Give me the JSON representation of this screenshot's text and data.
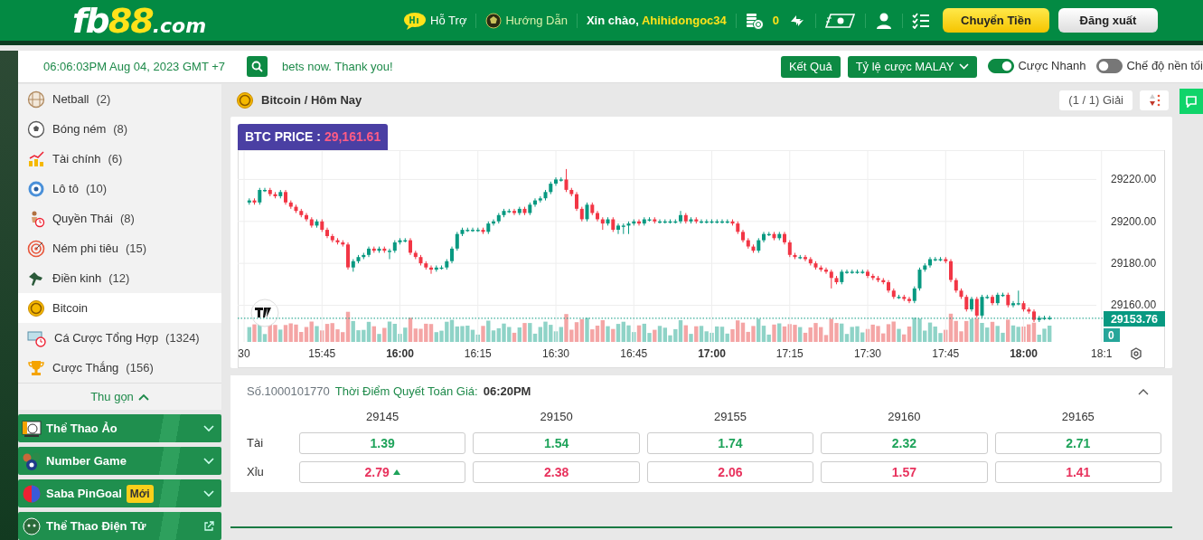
{
  "header": {
    "logo": {
      "part_1": "fb",
      "part_2": "88",
      "part_3": ".com"
    },
    "links": [
      {
        "label": "Hỗ Trợ",
        "kind": "support"
      },
      {
        "label": "Hướng Dẫn",
        "kind": "guide"
      }
    ],
    "greeting": "Xin chào,",
    "username": "Ahihidongoc34",
    "balance": "0",
    "transfer_button": "Chuyển Tiền",
    "logout_button": "Đăng xuất"
  },
  "toolbar": {
    "clock": "06:06:03PM Aug 04, 2023 GMT +7",
    "ticker": "bets now. Thank you!",
    "results_button": "Kết Quả",
    "odds_dropdown": "Tỷ lệ cược MALAY",
    "toggles": [
      {
        "label": "Cược Nhanh",
        "on": true
      },
      {
        "label": "Chế độ nền tối",
        "on": false
      }
    ]
  },
  "sidebar": {
    "items": [
      {
        "label": "Netball",
        "count": "(2)",
        "kind": "netball",
        "selected": false
      },
      {
        "label": "Bóng ném",
        "count": "(8)",
        "kind": "handball",
        "selected": false
      },
      {
        "label": "Tài chính",
        "count": "(6)",
        "kind": "finance",
        "selected": false
      },
      {
        "label": "Lô tô",
        "count": "(10)",
        "kind": "lotto",
        "selected": false
      },
      {
        "label": "Quyền Thái",
        "count": "(8)",
        "kind": "boxing",
        "selected": false
      },
      {
        "label": "Ném phi tiêu",
        "count": "(15)",
        "kind": "darts",
        "selected": false
      },
      {
        "label": "Điền kinh",
        "count": "(12)",
        "kind": "athletics",
        "selected": false
      },
      {
        "label": "Bitcoin",
        "kind": "bitcoin",
        "selected": true
      },
      {
        "label": "Cá Cược Tổng Hợp",
        "count": "(1324)",
        "kind": "combo",
        "selected": false
      },
      {
        "label": "Cược Thắng",
        "count": "(156)",
        "kind": "trophy",
        "selected": false
      }
    ],
    "collapse_label": "Thu gọn",
    "sections": [
      {
        "label": "Thể Thao Ảo",
        "kind": "virtual"
      },
      {
        "label": "Number Game",
        "kind": "number"
      },
      {
        "label": "Saba PinGoal",
        "kind": "pingoal",
        "badge": "Mới"
      },
      {
        "label": "Thể Thao Điện Tử",
        "kind": "esports"
      }
    ]
  },
  "main": {
    "breadcrumb": "Bitcoin / Hôm Nay",
    "league_counter": "(1 / 1) Giải",
    "price_badge": {
      "label": "BTC PRICE :",
      "value": "29,161.61"
    },
    "price_chart": {
      "last_price": "29153.76",
      "volume": "0",
      "chart_data": {
        "type": "candlestick",
        "categories": [
          "30",
          null,
          null,
          null,
          null,
          null,
          null,
          null,
          null,
          null,
          null,
          null,
          null,
          null,
          null,
          "15:45",
          null,
          null,
          null,
          null,
          null,
          null,
          null,
          null,
          null,
          null,
          null,
          null,
          null,
          null,
          "16:00",
          null,
          null,
          null,
          null,
          null,
          null,
          null,
          null,
          null,
          null,
          null,
          null,
          null,
          null,
          "16:15",
          null,
          null,
          null,
          null,
          null,
          null,
          null,
          null,
          null,
          null,
          null,
          null,
          null,
          null,
          "16:30",
          null,
          null,
          null,
          null,
          null,
          null,
          null,
          null,
          null,
          null,
          null,
          null,
          null,
          null,
          "16:45",
          null,
          null,
          null,
          null,
          null,
          null,
          null,
          null,
          null,
          null,
          null,
          null,
          null,
          null,
          "17:00",
          null,
          null,
          null,
          null,
          null,
          null,
          null,
          null,
          null,
          null,
          null,
          null,
          null,
          null,
          "17:15",
          null,
          null,
          null,
          null,
          null,
          null,
          null,
          null,
          null,
          null,
          null,
          null,
          null,
          null,
          "17:30",
          null,
          null,
          null,
          null,
          null,
          null,
          null,
          null,
          null,
          null,
          null,
          null,
          null,
          null,
          "17:45",
          null,
          null,
          null,
          null,
          null,
          null,
          null,
          null,
          null,
          null,
          null,
          null,
          null,
          null,
          "18:00",
          null,
          null,
          null,
          null,
          null,
          null,
          null,
          null,
          null,
          null,
          null,
          null,
          null,
          null,
          "18:1"
        ],
        "ohlc": [
          null,
          [
            29209,
            29211,
            29208,
            29210
          ],
          [
            29210,
            29211,
            29208,
            29209
          ],
          [
            29209,
            29216,
            29208,
            29215
          ],
          [
            29215,
            29216,
            29214,
            29215
          ],
          [
            29215,
            29216,
            29212,
            29213
          ],
          [
            29213,
            29214,
            29211,
            29212
          ],
          [
            29212,
            29215,
            29211,
            29214
          ],
          [
            29214,
            29215,
            29208,
            29209
          ],
          [
            29209,
            29210,
            29206,
            29207
          ],
          [
            29207,
            29208,
            29204,
            29205
          ],
          [
            29205,
            29206,
            29202,
            29203
          ],
          [
            29203,
            29204,
            29200,
            29201
          ],
          [
            29201,
            29202,
            29197,
            29198
          ],
          [
            29198,
            29201,
            29197,
            29200
          ],
          [
            29200,
            29201,
            29195,
            29196
          ],
          [
            29196,
            29197,
            29192,
            29193
          ],
          [
            29193,
            29194,
            29190,
            29191
          ],
          [
            29191,
            29192,
            29189,
            29190
          ],
          [
            29190,
            29191,
            29188,
            29189
          ],
          [
            29189,
            29190,
            29177,
            29178
          ],
          [
            29178,
            29182,
            29176,
            29181
          ],
          [
            29181,
            29184,
            29180,
            29183
          ],
          [
            29183,
            29185,
            29182,
            29184
          ],
          [
            29184,
            29188,
            29183,
            29187
          ],
          [
            29187,
            29188,
            29185,
            29186
          ],
          [
            29186,
            29188,
            29185,
            29187
          ],
          [
            29187,
            29188,
            29185,
            29186
          ],
          [
            29186,
            29187,
            29182,
            29186
          ],
          [
            29186,
            29191,
            29185,
            29190
          ],
          [
            29190,
            29192,
            29189,
            29191
          ],
          [
            29191,
            29192,
            29190,
            29191
          ],
          [
            29191,
            29192,
            29184,
            29185
          ],
          [
            29185,
            29186,
            29182,
            29183
          ],
          [
            29183,
            29184,
            29179,
            29180
          ],
          [
            29180,
            29181,
            29177,
            29178
          ],
          [
            29178,
            29179,
            29175,
            29177
          ],
          [
            29177,
            29179,
            29176,
            29178
          ],
          [
            29178,
            29179,
            29177,
            29178
          ],
          [
            29178,
            29182,
            29177,
            29181
          ],
          [
            29181,
            29188,
            29180,
            29187
          ],
          [
            29187,
            29195,
            29186,
            29194
          ],
          [
            29194,
            29197,
            29193,
            29196
          ],
          [
            29196,
            29197,
            29195,
            29196
          ],
          [
            29196,
            29197,
            29195,
            29196
          ],
          [
            29196,
            29197,
            29195,
            29196
          ],
          [
            29196,
            29197,
            29194,
            29195
          ],
          [
            29195,
            29200,
            29194,
            29199
          ],
          [
            29199,
            29201,
            29198,
            29200
          ],
          [
            29200,
            29204,
            29199,
            29203
          ],
          [
            29203,
            29206,
            29202,
            29205
          ],
          [
            29205,
            29206,
            29204,
            29205
          ],
          [
            29205,
            29206,
            29203,
            29204
          ],
          [
            29204,
            29207,
            29203,
            29206
          ],
          [
            29206,
            29207,
            29203,
            29204
          ],
          [
            29204,
            29209,
            29203,
            29208
          ],
          [
            29208,
            29211,
            29207,
            29210
          ],
          [
            29210,
            29212,
            29209,
            29211
          ],
          [
            29211,
            29215,
            29210,
            29214
          ],
          [
            29214,
            29219,
            29213,
            29218
          ],
          [
            29218,
            29221,
            29217,
            29220
          ],
          [
            29220,
            29221,
            29219,
            29220
          ],
          [
            29220,
            29225,
            29214,
            29215
          ],
          [
            29215,
            29216,
            29212,
            29213
          ],
          [
            29213,
            29214,
            29205,
            29206
          ],
          [
            29206,
            29207,
            29200,
            29201
          ],
          [
            29201,
            29209,
            29200,
            29208
          ],
          [
            29208,
            29209,
            29203,
            29204
          ],
          [
            29204,
            29205,
            29200,
            29201
          ],
          [
            29201,
            29202,
            29196,
            29199
          ],
          [
            29199,
            29202,
            29198,
            29201
          ],
          [
            29201,
            29202,
            29195,
            29196
          ],
          [
            29196,
            29199,
            29194,
            29198
          ],
          [
            29198,
            29199,
            29194,
            29198
          ],
          [
            29198,
            29200,
            29194,
            29199
          ],
          [
            29199,
            29201,
            29198,
            29200
          ],
          [
            29200,
            29201,
            29198,
            29199
          ],
          [
            29199,
            29202,
            29198,
            29201
          ],
          [
            29201,
            29202,
            29200,
            29201
          ],
          [
            29201,
            29202,
            29199,
            29200
          ],
          [
            29200,
            29201,
            29199,
            29200
          ],
          [
            29200,
            29201,
            29199,
            29200
          ],
          [
            29200,
            29201,
            29199,
            29200
          ],
          [
            29200,
            29201,
            29199,
            29200
          ],
          [
            29200,
            29205,
            29199,
            29203
          ],
          [
            29203,
            29204,
            29199,
            29200
          ],
          [
            29200,
            29202,
            29199,
            29201
          ],
          [
            29201,
            29202,
            29199,
            29200
          ],
          [
            29200,
            29201,
            29199,
            29200
          ],
          [
            29200,
            29201,
            29199,
            29200
          ],
          [
            29200,
            29201,
            29199,
            29200
          ],
          [
            29200,
            29201,
            29199,
            29200
          ],
          [
            29200,
            29201,
            29199,
            29200
          ],
          [
            29200,
            29201,
            29199,
            29200
          ],
          [
            29200,
            29201,
            29198,
            29199
          ],
          [
            29199,
            29200,
            29194,
            29195
          ],
          [
            29195,
            29196,
            29190,
            29191
          ],
          [
            29191,
            29192,
            29187,
            29188
          ],
          [
            29188,
            29189,
            29185,
            29186
          ],
          [
            29186,
            29192,
            29185,
            29191
          ],
          [
            29191,
            29195,
            29190,
            29194
          ],
          [
            29194,
            29195,
            29193,
            29194
          ],
          [
            29194,
            29195,
            29191,
            29192
          ],
          [
            29192,
            29195,
            29191,
            29194
          ],
          [
            29194,
            29195,
            29189,
            29190
          ],
          [
            29190,
            29191,
            29183,
            29184
          ],
          [
            29184,
            29185,
            29182,
            29183
          ],
          [
            29183,
            29184,
            29182,
            29183
          ],
          [
            29183,
            29184,
            29181,
            29182
          ],
          [
            29182,
            29183,
            29179,
            29180
          ],
          [
            29180,
            29181,
            29177,
            29178
          ],
          [
            29178,
            29179,
            29176,
            29177
          ],
          [
            29177,
            29178,
            29175,
            29176
          ],
          [
            29176,
            29177,
            29168,
            29173
          ],
          [
            29173,
            29174,
            29170,
            29171
          ],
          [
            29171,
            29177,
            29170,
            29176
          ],
          [
            29176,
            29177,
            29175,
            29176
          ],
          [
            29176,
            29177,
            29175,
            29176
          ],
          [
            29176,
            29177,
            29175,
            29176
          ],
          [
            29176,
            29177,
            29175,
            29176
          ],
          [
            29176,
            29177,
            29173,
            29174
          ],
          [
            29174,
            29175,
            29172,
            29173
          ],
          [
            29173,
            29174,
            29171,
            29172
          ],
          [
            29172,
            29173,
            29170,
            29171
          ],
          [
            29171,
            29172,
            29166,
            29167
          ],
          [
            29167,
            29168,
            29163,
            29164
          ],
          [
            29164,
            29165,
            29163,
            29164
          ],
          [
            29164,
            29165,
            29162,
            29163
          ],
          [
            29163,
            29164,
            29161,
            29162
          ],
          [
            29162,
            29169,
            29161,
            29168
          ],
          [
            29168,
            29178,
            29167,
            29177
          ],
          [
            29177,
            29180,
            29176,
            29179
          ],
          [
            29179,
            29183,
            29178,
            29182
          ],
          [
            29182,
            29183,
            29181,
            29182
          ],
          [
            29182,
            29183,
            29181,
            29182
          ],
          [
            29182,
            29183,
            29180,
            29181
          ],
          [
            29181,
            29182,
            29171,
            29172
          ],
          [
            29172,
            29173,
            29166,
            29167
          ],
          [
            29167,
            29168,
            29163,
            29164
          ],
          [
            29164,
            29165,
            29157,
            29158
          ],
          [
            29158,
            29164,
            29157,
            29163
          ],
          [
            29163,
            29164,
            29154,
            29155
          ],
          [
            29155,
            29165,
            29154,
            29164
          ],
          [
            29164,
            29165,
            29163,
            29164
          ],
          [
            29164,
            29165,
            29160,
            29161
          ],
          [
            29161,
            29166,
            29160,
            29165
          ],
          [
            29165,
            29166,
            29164,
            29165
          ],
          [
            29165,
            29166,
            29159,
            29160
          ],
          [
            29160,
            29162,
            29159,
            29161
          ],
          [
            29161,
            29167,
            29160,
            29161
          ],
          [
            29161,
            29162,
            29157,
            29158
          ],
          [
            29158,
            29159,
            29156,
            29157
          ],
          [
            29157,
            29158,
            29152,
            29153
          ],
          [
            29153,
            29155,
            29152,
            29154
          ],
          [
            29154,
            29155,
            29153,
            29154
          ],
          [
            29154,
            29155,
            29153,
            29154
          ],
          null,
          null,
          null,
          null,
          null,
          null,
          null,
          null,
          null,
          null
        ],
        "ylim": [
          29130,
          29234
        ],
        "grid": true,
        "ref_lines": [
          {
            "axis": "y",
            "value": 29153.76
          }
        ],
        "yticks": [
          {
            "value": 29220,
            "label": "29220.00"
          },
          {
            "value": 29200,
            "label": "29200.00"
          },
          {
            "value": 29180,
            "label": "29180.00"
          },
          {
            "value": 29160,
            "label": "29160.00"
          }
        ]
      }
    },
    "market": {
      "number": "Số.1000101770",
      "settle_label": "Thời Điểm Quyết Toán Giá:",
      "settle_time": "06:20PM",
      "expanded": true,
      "columns": [
        "29145",
        "29150",
        "29155",
        "29160",
        "29165"
      ],
      "rows": [
        {
          "label": "Tài",
          "kind": "over",
          "odds": [
            {
              "value": "1.39",
              "rising": false
            },
            {
              "value": "1.54",
              "rising": false
            },
            {
              "value": "1.74",
              "rising": false
            },
            {
              "value": "2.32",
              "rising": false
            },
            {
              "value": "2.71",
              "rising": false
            }
          ]
        },
        {
          "label": "Xỉu",
          "kind": "under",
          "odds": [
            {
              "value": "2.79",
              "rising": true
            },
            {
              "value": "2.38",
              "rising": false
            },
            {
              "value": "2.06",
              "rising": false
            },
            {
              "value": "1.57",
              "rising": false
            },
            {
              "value": "1.41",
              "rising": false
            }
          ]
        }
      ]
    }
  }
}
